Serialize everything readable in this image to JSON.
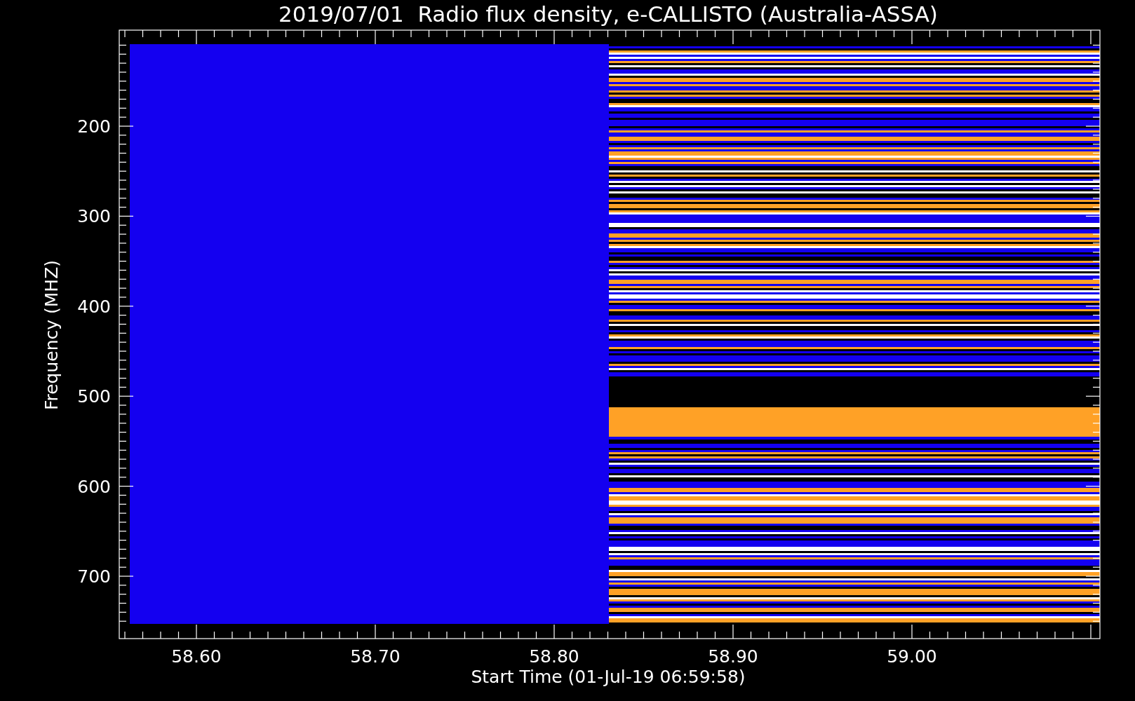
{
  "title": "2019/07/01  Radio flux density, e-CALLISTO (Australia-ASSA)",
  "plot": {
    "ylabel": "Frequency (MHZ)",
    "xlabel": "Start Time (01-Jul-19 06:59:58)",
    "yticks": [
      "200",
      "300",
      "400",
      "500",
      "600",
      "700"
    ],
    "xticks": [
      "58.60",
      "58.70",
      "58.80",
      "58.90",
      "59.00"
    ]
  }
}
